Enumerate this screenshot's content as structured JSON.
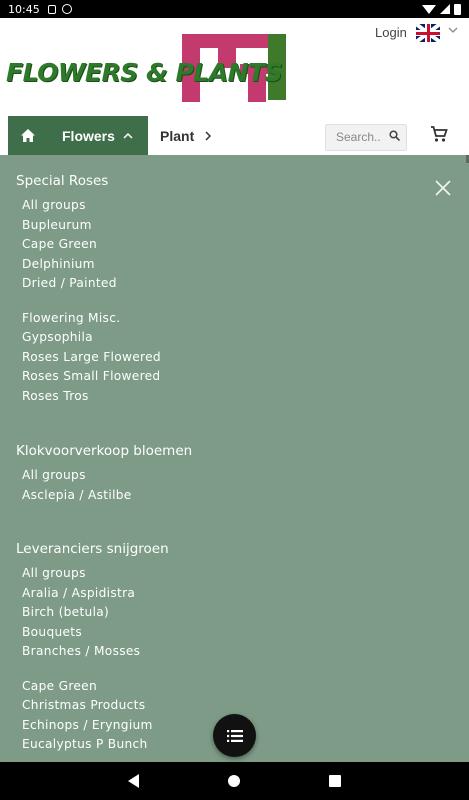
{
  "status_bar": {
    "time": "10:45"
  },
  "header": {
    "logo_text": "FLOWERS & PLANTS",
    "login_label": "Login",
    "language_flag": "uk-flag-icon"
  },
  "nav": {
    "home_icon": "home-icon",
    "flowers_label": "Flowers",
    "plant_label": "Plant",
    "search_placeholder": "Search..",
    "cart_icon": "cart-icon"
  },
  "colors": {
    "nav_active": "#3f6e4b",
    "overlay_bg": "#7d9b86",
    "logo_green": "#2e7a2a",
    "logo_magenta": "#c23a6e"
  },
  "menu": {
    "groups": [
      {
        "title": "Special Roses",
        "items": [
          "All groups",
          "Bupleurum",
          "Cape Green",
          "Delphinium",
          "Dried / Painted"
        ],
        "items2": [
          "Flowering Misc.",
          "Gypsophila",
          "Roses Large Flowered",
          "Roses Small Flowered",
          "Roses Tros"
        ]
      },
      {
        "title": "Klokvoorverkoop bloemen",
        "items": [
          "All groups",
          "Asclepia / Astilbe"
        ]
      },
      {
        "title": "Leveranciers snijgroen",
        "items": [
          "All groups",
          "Aralia / Aspidistra",
          "Birch (betula)",
          "Bouquets",
          "Branches / Mosses"
        ],
        "items2": [
          "Cape Green",
          "Christmas Products",
          "Echinops / Eryngium",
          "Eucalyptus P Bunch"
        ]
      }
    ]
  }
}
